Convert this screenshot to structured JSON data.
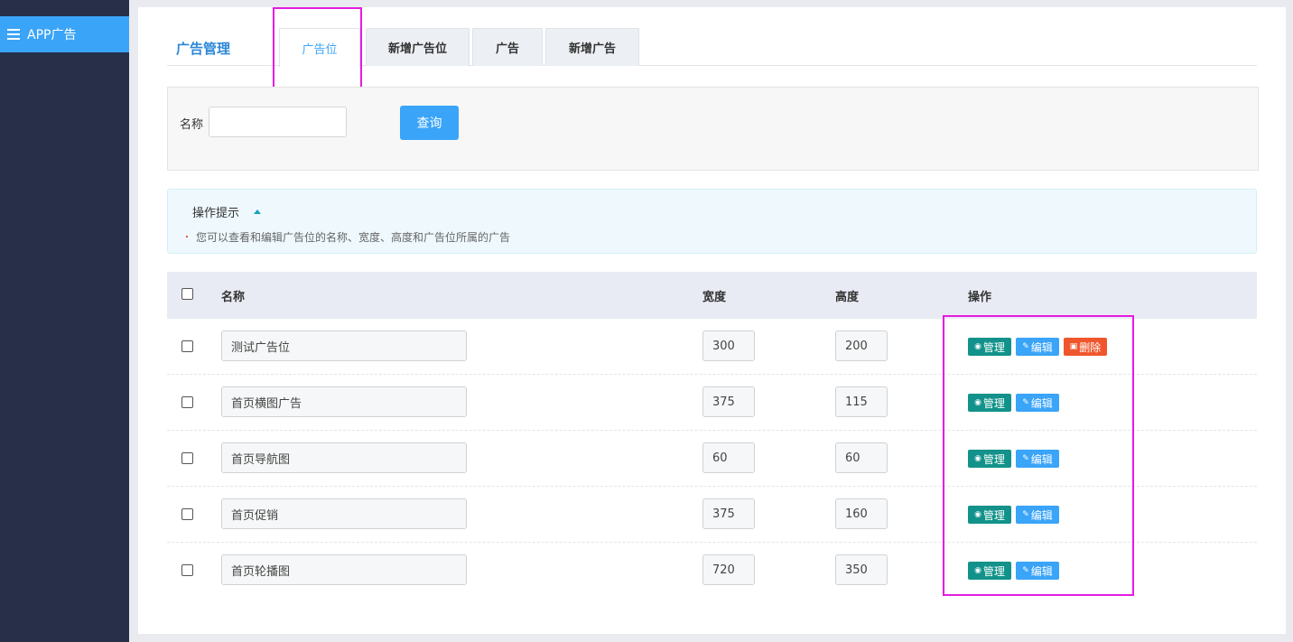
{
  "sidebar": {
    "item_label": "APP广告"
  },
  "header": {
    "title": "广告管理",
    "tabs": [
      {
        "label": "广告位",
        "active": true
      },
      {
        "label": "新增广告位",
        "active": false
      },
      {
        "label": "广告",
        "active": false
      },
      {
        "label": "新增广告",
        "active": false
      }
    ]
  },
  "search": {
    "label": "名称",
    "input_value": "",
    "button_label": "查询"
  },
  "tips": {
    "title": "操作提示",
    "text": "您可以查看和编辑广告位的名称、宽度、高度和广告位所属的广告"
  },
  "table": {
    "headers": {
      "name": "名称",
      "width": "宽度",
      "height": "高度",
      "actions": "操作"
    },
    "rows": [
      {
        "name": "测试广告位",
        "width": "300",
        "height": "200",
        "actions": [
          "管理",
          "编辑",
          "删除"
        ]
      },
      {
        "name": "首页横图广告",
        "width": "375",
        "height": "115",
        "actions": [
          "管理",
          "编辑"
        ]
      },
      {
        "name": "首页导航图",
        "width": "60",
        "height": "60",
        "actions": [
          "管理",
          "编辑"
        ]
      },
      {
        "name": "首页促销",
        "width": "375",
        "height": "160",
        "actions": [
          "管理",
          "编辑"
        ]
      },
      {
        "name": "首页轮播图",
        "width": "720",
        "height": "350",
        "actions": [
          "管理",
          "编辑"
        ]
      }
    ]
  },
  "colors": {
    "accent": "#3aa4f8",
    "sidebar_bg": "#273048",
    "manage": "#12928a",
    "delete": "#f0562c",
    "highlight": "#e61be0"
  }
}
